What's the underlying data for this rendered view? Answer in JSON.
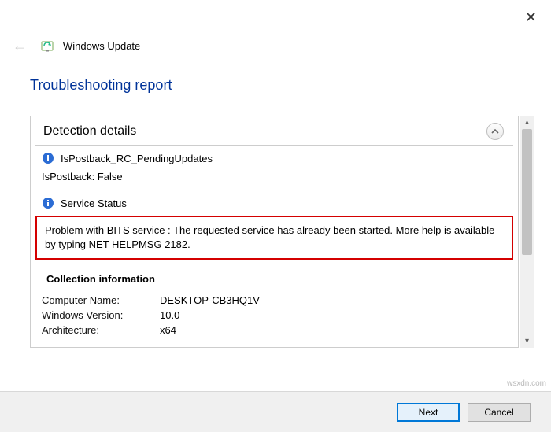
{
  "window": {
    "header_title": "Windows Update",
    "close_label": "✕"
  },
  "page": {
    "title": "Troubleshooting report"
  },
  "detection": {
    "section_title": "Detection details",
    "items": [
      {
        "label": "IsPostback_RC_PendingUpdates"
      },
      {
        "sub": "IsPostback: False"
      },
      {
        "label": "Service Status"
      }
    ],
    "problem_text": "Problem with BITS service : The requested service has already been started. More help is available by typing NET HELPMSG 2182."
  },
  "collection": {
    "section_title": "Collection information",
    "rows": [
      {
        "key": "Computer Name:",
        "val": "DESKTOP-CB3HQ1V"
      },
      {
        "key": "Windows Version:",
        "val": "10.0"
      },
      {
        "key": "Architecture:",
        "val": "x64"
      }
    ]
  },
  "footer": {
    "next": "Next",
    "cancel": "Cancel"
  },
  "watermark": "wsxdn.com"
}
